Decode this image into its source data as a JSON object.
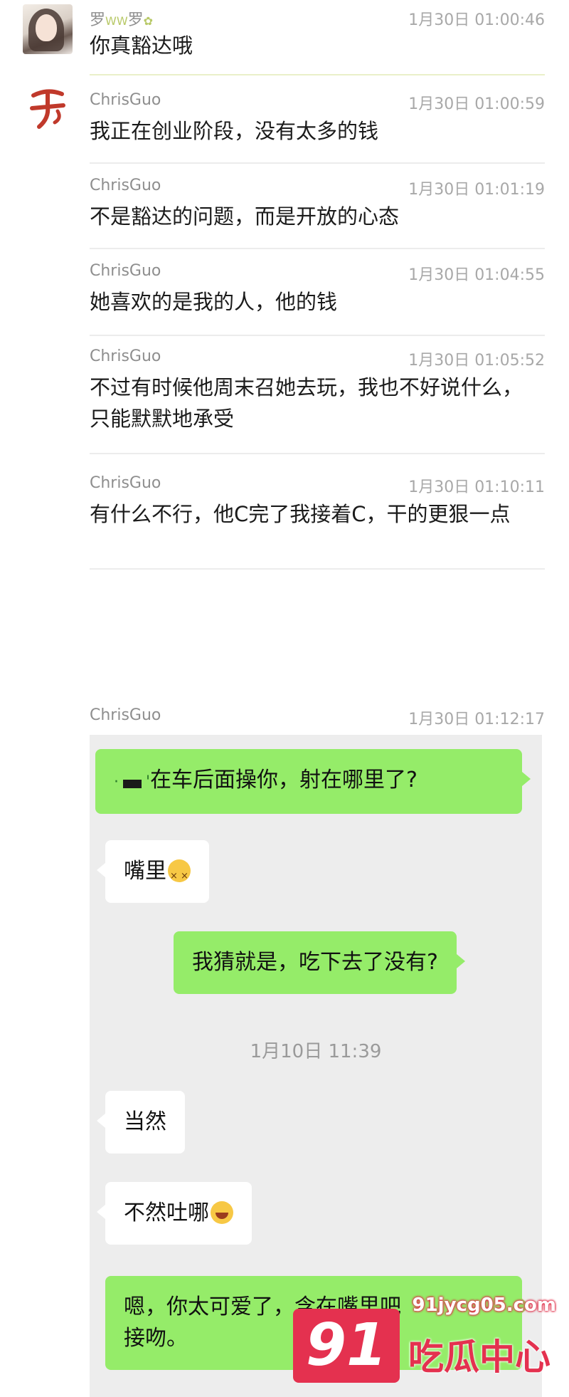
{
  "messages": [
    {
      "sender": "罗",
      "sender_tail": "罗",
      "time": "1月30日 01:00:46",
      "text": "你真豁达哦"
    },
    {
      "sender": "ChrisGuo",
      "time": "1月30日 01:00:59",
      "text": "我正在创业阶段，没有太多的钱"
    },
    {
      "sender": "ChrisGuo",
      "time": "1月30日 01:01:19",
      "text": "不是豁达的问题，而是开放的心态"
    },
    {
      "sender": "ChrisGuo",
      "time": "1月30日 01:04:55",
      "text": "她喜欢的是我的人，他的钱"
    },
    {
      "sender": "ChrisGuo",
      "time": "1月30日 01:05:52",
      "text": "不过有时候他周末召她去玩，我也不好说什么，只能默默地承受"
    },
    {
      "sender": "ChrisGuo",
      "time": "1月30日 01:10:11",
      "text": "有什么不行，他C完了我接着C，干的更狠一点"
    },
    {
      "sender": "ChrisGuo",
      "time": "1月30日 01:12:17"
    }
  ],
  "screenshot": {
    "bubble1": "在车后面操你，射在哪里了?",
    "bubble2": "嘴里",
    "bubble3": "我猜就是，吃下去了没有?",
    "timestamp": "1月10日 11:39",
    "bubble4": "当然",
    "bubble5": "不然吐哪",
    "bubble6_line1": "嗯，你太可爱了，含在嘴里吧",
    "bubble6_line2": "接吻。"
  },
  "watermark": {
    "url": "91jycg05.com",
    "logo": "91",
    "name": "吃瓜中心",
    "brand_color": "#e4314f"
  },
  "colors": {
    "green_bubble": "#95ec69",
    "white_bubble": "#ffffff",
    "screenshot_bg": "#ededed"
  },
  "icons": [
    "user-photo-avatar-icon",
    "seal-avatar-icon",
    "dizzy-face-emoji-icon",
    "laughing-emoji-icon"
  ]
}
